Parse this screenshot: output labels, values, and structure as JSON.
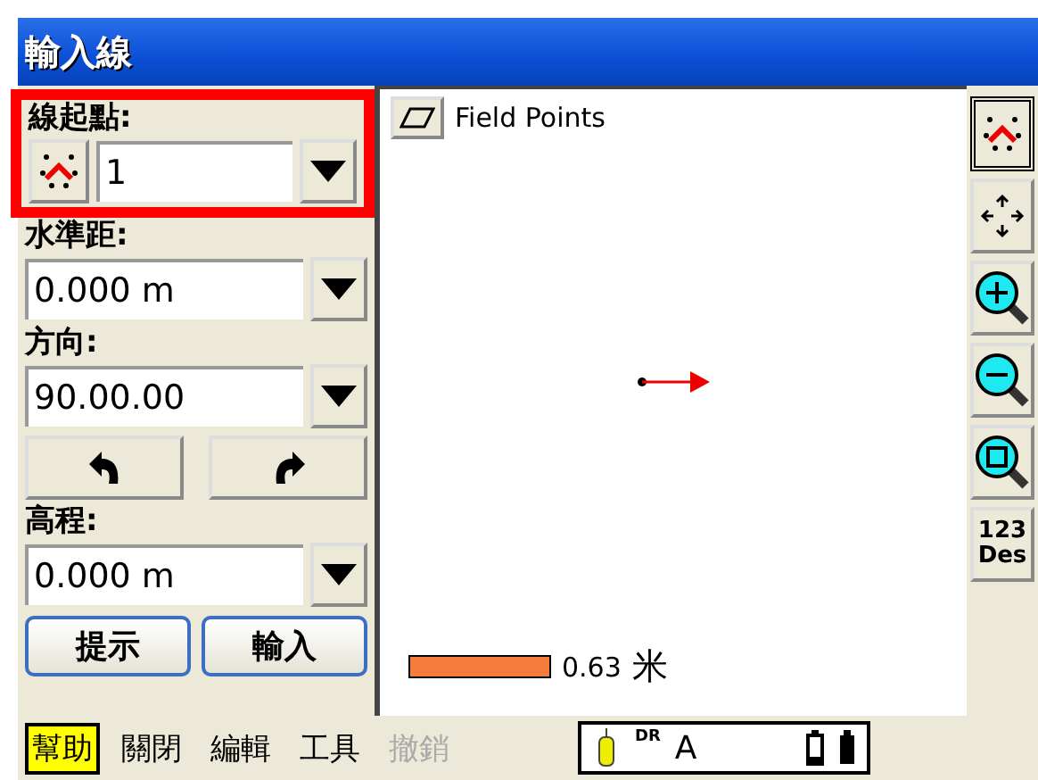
{
  "window": {
    "title": "輸入線"
  },
  "form": {
    "start_point": {
      "label": "線起點:",
      "value": "1",
      "highlighted": true
    },
    "fields": [
      {
        "label": "水準距:",
        "value": "0.000 m"
      },
      {
        "label": "方向:",
        "value": "90.00.00"
      }
    ],
    "elevation": {
      "label": "高程:",
      "value": "0.000 m"
    }
  },
  "buttons": [
    "提示",
    "輸入"
  ],
  "map": {
    "layer": "Field Points",
    "scale": "0.63",
    "scale_unit": "米"
  },
  "toolbar": [
    {
      "kind": "select",
      "selected": true
    },
    {
      "kind": "pan",
      "selected": false
    },
    {
      "kind": "zoom-in",
      "selected": false
    },
    {
      "kind": "zoom-out",
      "selected": false
    },
    {
      "kind": "zoom-extent",
      "selected": false
    },
    {
      "kind": "text",
      "line_1": "123",
      "line_2": "Des",
      "selected": false
    }
  ],
  "menu": [
    {
      "label": "幫助",
      "selected": true,
      "disabled": false
    },
    {
      "label": "關閉",
      "selected": false,
      "disabled": false
    },
    {
      "label": "編輯",
      "selected": false,
      "disabled": false
    },
    {
      "label": "工具",
      "selected": false,
      "disabled": false
    },
    {
      "label": "撤銷",
      "selected": false,
      "disabled": true
    }
  ],
  "status": {
    "mode": "DR",
    "label": "A"
  }
}
